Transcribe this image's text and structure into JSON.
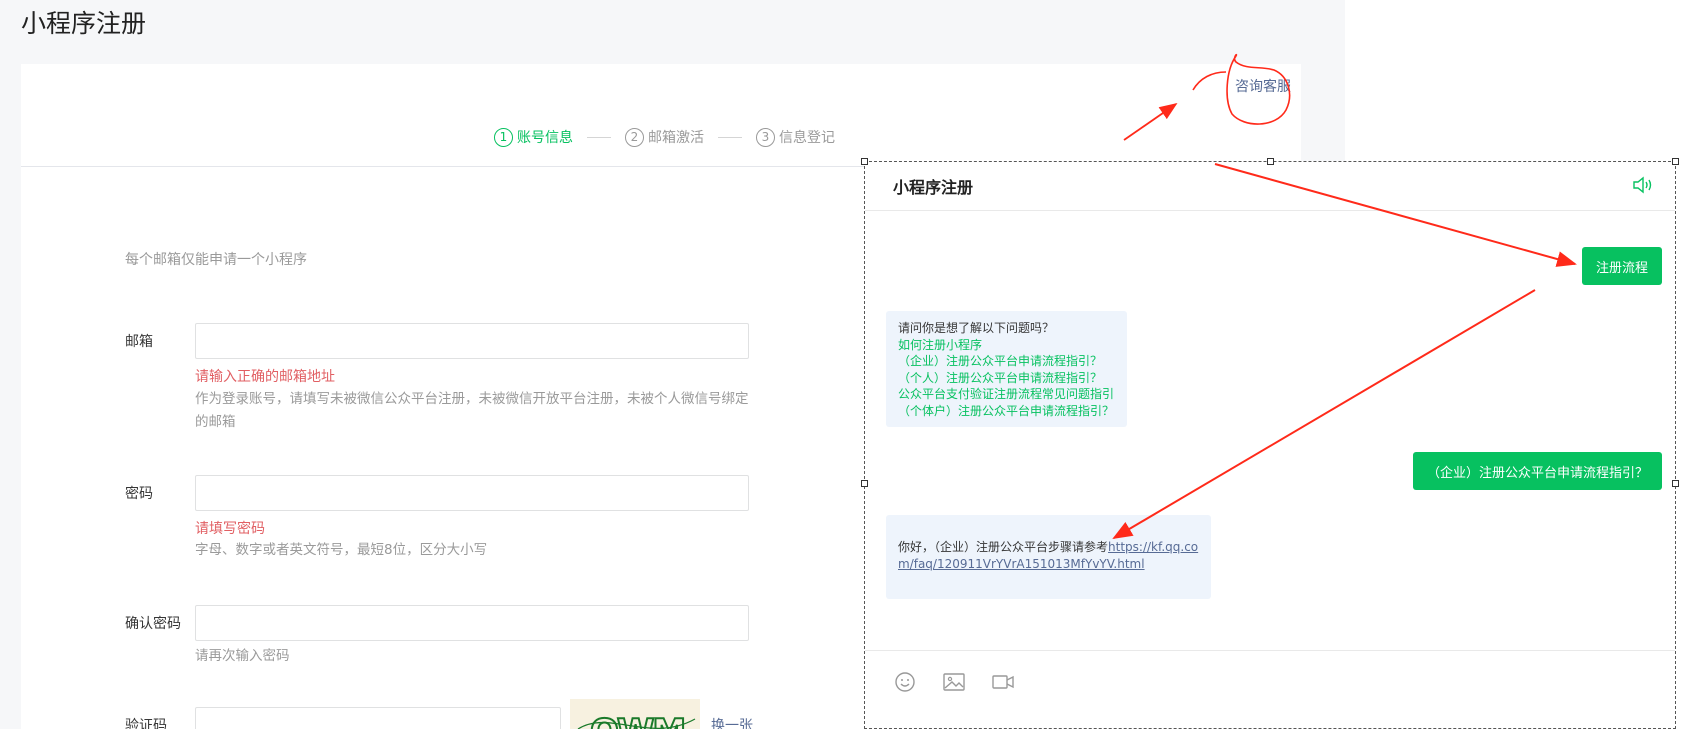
{
  "page": {
    "title": "小程序注册"
  },
  "header": {
    "support_link": "咨询客服"
  },
  "steps": [
    {
      "num": "1",
      "label": "账号信息",
      "active": true
    },
    {
      "num": "2",
      "label": "邮箱激活",
      "active": false
    },
    {
      "num": "3",
      "label": "信息登记",
      "active": false
    }
  ],
  "form": {
    "tip": "每个邮箱仅能申请一个小程序",
    "email": {
      "label": "邮箱",
      "value": "",
      "error": "请输入正确的邮箱地址",
      "hint": "作为登录账号，请填写未被微信公众平台注册，未被微信开放平台注册，未被个人微信号绑定的邮箱"
    },
    "password": {
      "label": "密码",
      "value": "",
      "error": "请填写密码",
      "hint": "字母、数字或者英文符号，最短8位，区分大小写"
    },
    "confirm": {
      "label": "确认密码",
      "value": "",
      "hint": "请再次输入密码"
    },
    "captcha": {
      "label": "验证码",
      "value": "",
      "refresh": "换一张",
      "image_text": "QWM"
    }
  },
  "chat": {
    "title": "小程序注册",
    "user_msg_1": "注册流程",
    "bot_msg_1": {
      "intro": "请问你是想了解以下问题吗？",
      "questions": [
        "如何注册小程序",
        "（企业）注册公众平台申请流程指引？",
        "（个人）注册公众平台申请流程指引？",
        "公众平台支付验证注册流程常见问题指引",
        "（个体户）注册公众平台申请流程指引？"
      ]
    },
    "user_msg_2": "（企业）注册公众平台申请流程指引？",
    "bot_msg_2": {
      "text": "你好，（企业）注册公众平台步骤请参考",
      "link": "https://kf.qq.com/faq/120911VrYVrA151013MfYvYV.html"
    },
    "footer_icons": [
      "emoji-icon",
      "image-icon",
      "video-icon"
    ]
  },
  "colors": {
    "accent": "#07c160",
    "link": "#576b95",
    "error": "#e15f63",
    "annotation": "#ff2a1a"
  }
}
